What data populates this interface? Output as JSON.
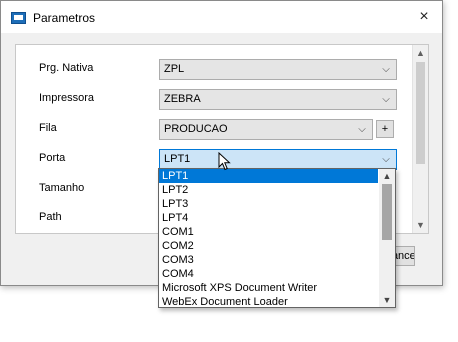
{
  "window": {
    "title": "Parametros",
    "close_icon": "×"
  },
  "form": {
    "fields": [
      {
        "label": "Prg. Nativa",
        "value": "ZPL"
      },
      {
        "label": "Impressora",
        "value": "ZEBRA"
      },
      {
        "label": "Fila",
        "value": "PRODUCAO"
      },
      {
        "label": "Porta",
        "value": "LPT1"
      },
      {
        "label": "Tamanho"
      },
      {
        "label": "Path"
      }
    ],
    "add_button": "+",
    "chevron": "⌵"
  },
  "dropdown": {
    "options": [
      "LPT1",
      "LPT2",
      "LPT3",
      "LPT4",
      "COM1",
      "COM2",
      "COM3",
      "COM4",
      "Microsoft XPS Document Writer",
      "WebEx Document Loader"
    ],
    "selected": "LPT1"
  },
  "footer": {
    "cancel_label": "Cancelar"
  },
  "colors": {
    "selection": "#0078d7",
    "focus_bg": "#cce4f7"
  }
}
